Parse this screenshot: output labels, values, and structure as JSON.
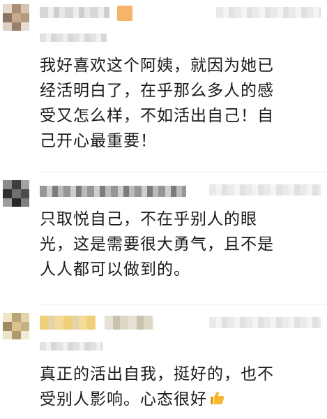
{
  "comments": [
    {
      "lines": [
        "我好喜欢这个阿姨，就因为她已",
        "经活明白了，在乎那么多人的感",
        "受又怎么样，不如活出自己！自",
        "己开心最重要！"
      ]
    },
    {
      "lines": [
        "只取悦自己，不在乎别人的眼",
        "光，这是需要很大勇气，且不是",
        "人人都可以做到的。"
      ]
    },
    {
      "lines": [
        "真正的活出自我，挺好的，也不",
        "受别人影响。心态很好"
      ],
      "emoji": "thumbs-up-icon"
    }
  ],
  "colors": {
    "text": "#1a1a1a",
    "thumb": "#f5b82e"
  }
}
